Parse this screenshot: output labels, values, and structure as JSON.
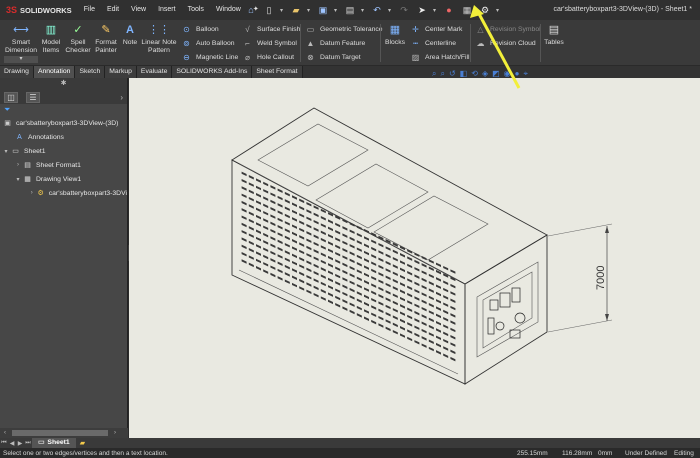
{
  "app": {
    "name": "SOLIDWORKS",
    "logo_mark": "3S",
    "doc_title": "car'sbatteryboxpart3-3DView-(3D) - Sheet1 *"
  },
  "menu": [
    "File",
    "Edit",
    "View",
    "Insert",
    "Tools",
    "Window"
  ],
  "ribbon": {
    "smart_dimension": "Smart Dimension",
    "model_items": "Model Items",
    "spell_checker": "Spell Checker",
    "format_painter": "Format Painter",
    "note": "Note",
    "linear_note_pattern": "Linear Note Pattern",
    "balloon": "Balloon",
    "auto_balloon": "Auto Balloon",
    "magnetic_line": "Magnetic Line",
    "surface_finish": "Surface Finish",
    "weld_symbol": "Weld Symbol",
    "hole_callout": "Hole Callout",
    "geometric_tolerance": "Geometric Tolerance",
    "datum_feature": "Datum Feature",
    "datum_target": "Datum Target",
    "blocks": "Blocks",
    "center_mark": "Center Mark",
    "centerline": "Centerline",
    "area_hatch": "Area Hatch/Fill",
    "revision_symbol": "Revision Symbol",
    "revision_cloud": "Revision Cloud",
    "tables": "Tables"
  },
  "tabs": [
    "Drawing",
    "Annotation",
    "Sketch",
    "Markup",
    "Evaluate",
    "SOLIDWORKS Add-Ins",
    "Sheet Format"
  ],
  "active_tab": "Annotation",
  "tree": {
    "root": "car'sbatteryboxpart3-3DView-(3D)",
    "annotations": "Annotations",
    "sheet": "Sheet1",
    "sheet_format": "Sheet Format1",
    "drawing_view": "Drawing View1",
    "part": "car'sbatteryboxpart3-3DVi"
  },
  "sheet_tab": "Sheet1",
  "dimension_value": "7000",
  "status": {
    "message": "Select one or two edges/vertices and then a text location.",
    "x": "255.15mm",
    "y": "116.28mm",
    "z": "0mm",
    "state": "Under Defined",
    "mode": "Editing"
  },
  "colors": {
    "accent_yellow": "#f2ef3a",
    "ui_dark": "#3a3a3a",
    "canvas": "#e9e9e1"
  }
}
